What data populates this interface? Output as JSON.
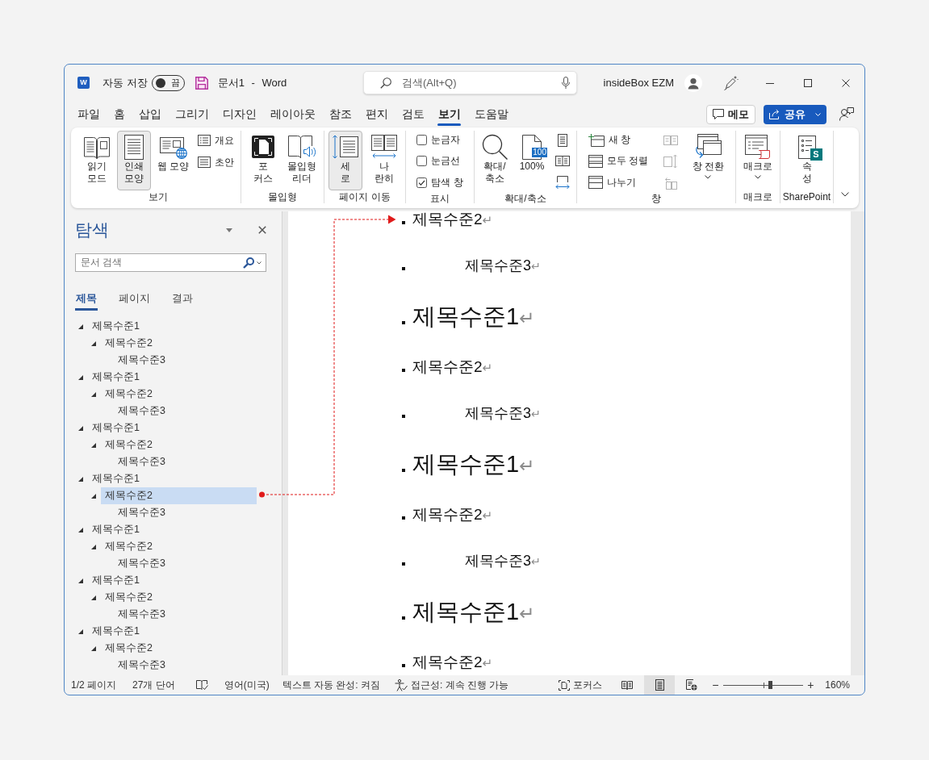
{
  "window": {
    "app_logo": "W",
    "autosave": {
      "label": "자동 저장",
      "on": false,
      "state_text": "끔"
    },
    "title": "문서1 - Word",
    "search": {
      "placeholder": "검색(Alt+Q)"
    },
    "user": "insideBox EZM"
  },
  "ribbon_tabs": [
    {
      "label": "파일",
      "selected": false
    },
    {
      "label": "홈",
      "selected": false
    },
    {
      "label": "삽입",
      "selected": false
    },
    {
      "label": "그리기",
      "selected": false
    },
    {
      "label": "디자인",
      "selected": false
    },
    {
      "label": "레이아웃",
      "selected": false
    },
    {
      "label": "참조",
      "selected": false
    },
    {
      "label": "편지",
      "selected": false
    },
    {
      "label": "검토",
      "selected": false
    },
    {
      "label": "보기",
      "selected": true
    },
    {
      "label": "도움말",
      "selected": false
    }
  ],
  "header_buttons": [
    {
      "kind": "comments",
      "label": "메모"
    },
    {
      "kind": "share",
      "label": "공유"
    }
  ],
  "ribbon": {
    "groups": [
      {
        "label": "보기",
        "items": [
          {
            "kind": "large",
            "label": "읽기\n모드",
            "selected": false
          },
          {
            "kind": "large",
            "label": "인쇄\n모양",
            "selected": true
          },
          {
            "kind": "large",
            "label": "웹 모양",
            "selected": false
          },
          {
            "kind": "stack",
            "items": [
              {
                "kind": "small",
                "label": "개요"
              },
              {
                "kind": "small",
                "label": "초안"
              }
            ]
          }
        ]
      },
      {
        "label": "몰입형",
        "items": [
          {
            "kind": "large",
            "label": "포\n커스"
          },
          {
            "kind": "large",
            "label": "몰입형\n리더"
          }
        ]
      },
      {
        "label": "페이지 이동",
        "items": [
          {
            "kind": "large",
            "label": "세\n로",
            "selected": true
          },
          {
            "kind": "large",
            "label": "나\n란히",
            "selected": false
          }
        ]
      },
      {
        "label": "표시",
        "items": [
          {
            "kind": "stack",
            "items": [
              {
                "kind": "checkbox",
                "label": "눈금자",
                "checked": false
              },
              {
                "kind": "checkbox",
                "label": "눈금선",
                "checked": false
              },
              {
                "kind": "checkbox",
                "label": "탐색 창",
                "checked": true
              }
            ]
          }
        ]
      },
      {
        "label": "확대/축소",
        "items": [
          {
            "kind": "large",
            "label": "확대/\n축소"
          },
          {
            "kind": "large",
            "label": "100%",
            "badge": "100"
          },
          {
            "kind": "stack",
            "items": [
              {
                "kind": "icon",
                "disabled": false
              },
              {
                "kind": "icon",
                "disabled": false
              },
              {
                "kind": "icon",
                "disabled": false
              }
            ]
          }
        ]
      },
      {
        "label": "창",
        "items": [
          {
            "kind": "stack",
            "items": [
              {
                "kind": "small",
                "label": "새 창"
              },
              {
                "kind": "small",
                "label": "모두 정렬"
              },
              {
                "kind": "small",
                "label": "나누기"
              }
            ]
          },
          {
            "kind": "stack",
            "items": [
              {
                "kind": "icon",
                "disabled": true
              },
              {
                "kind": "icon",
                "disabled": true
              },
              {
                "kind": "icon",
                "disabled": true
              }
            ]
          },
          {
            "kind": "large",
            "label": "창 전환",
            "dropdown": true
          }
        ]
      },
      {
        "label": "매크로",
        "items": [
          {
            "kind": "large",
            "label": "매크로",
            "dropdown": true
          }
        ]
      },
      {
        "label": "SharePoint",
        "items": [
          {
            "kind": "large",
            "label": "속\n성",
            "badge": "S"
          }
        ]
      }
    ]
  },
  "navigation": {
    "title": "탐색",
    "search": {
      "placeholder": "문서 검색"
    },
    "tabs": [
      {
        "label": "제목",
        "selected": true
      },
      {
        "label": "페이지",
        "selected": false
      },
      {
        "label": "결과",
        "selected": false
      }
    ],
    "headings": [
      {
        "text": "제목수준1",
        "expanded": true,
        "selected": false,
        "children": [
          {
            "text": "제목수준2",
            "expanded": true,
            "selected": false,
            "children": [
              {
                "text": "제목수준3",
                "selected": false
              }
            ]
          }
        ]
      },
      {
        "text": "제목수준1",
        "expanded": true,
        "selected": false,
        "children": [
          {
            "text": "제목수준2",
            "expanded": true,
            "selected": false,
            "children": [
              {
                "text": "제목수준3",
                "selected": false
              }
            ]
          }
        ]
      },
      {
        "text": "제목수준1",
        "expanded": true,
        "selected": false,
        "children": [
          {
            "text": "제목수준2",
            "expanded": true,
            "selected": false,
            "children": [
              {
                "text": "제목수준3",
                "selected": false
              }
            ]
          }
        ]
      },
      {
        "text": "제목수준1",
        "expanded": true,
        "selected": false,
        "children": [
          {
            "text": "제목수준2",
            "expanded": true,
            "selected": true,
            "children": [
              {
                "text": "제목수준3",
                "selected": false
              }
            ]
          }
        ]
      },
      {
        "text": "제목수준1",
        "expanded": true,
        "selected": false,
        "children": [
          {
            "text": "제목수준2",
            "expanded": true,
            "selected": false,
            "children": [
              {
                "text": "제목수준3",
                "selected": false
              }
            ]
          }
        ]
      },
      {
        "text": "제목수준1",
        "expanded": true,
        "selected": false,
        "children": [
          {
            "text": "제목수준2",
            "expanded": true,
            "selected": false,
            "children": [
              {
                "text": "제목수준3",
                "selected": false
              }
            ]
          }
        ]
      },
      {
        "text": "제목수준1",
        "expanded": true,
        "selected": false,
        "children": [
          {
            "text": "제목수준2",
            "expanded": true,
            "selected": false,
            "children": [
              {
                "text": "제목수준3",
                "selected": false
              }
            ]
          }
        ]
      }
    ]
  },
  "document": {
    "paragraphs": [
      {
        "kind": "heading2",
        "text": "제목수준2",
        "mark": "↵"
      },
      {
        "kind": "heading3",
        "text": "제목수준3",
        "mark": "↵"
      },
      {
        "kind": "heading1",
        "text": "제목수준1",
        "mark": "↵"
      },
      {
        "kind": "heading2",
        "text": "제목수준2",
        "mark": "↵"
      },
      {
        "kind": "heading3",
        "text": "제목수준3",
        "mark": "↵"
      },
      {
        "kind": "heading1",
        "text": "제목수준1",
        "mark": "↵"
      },
      {
        "kind": "heading2",
        "text": "제목수준2",
        "mark": "↵"
      },
      {
        "kind": "heading3",
        "text": "제목수준3",
        "mark": "↵"
      },
      {
        "kind": "heading1",
        "text": "제목수준1",
        "mark": "↵"
      },
      {
        "kind": "heading2",
        "text": "제목수준2",
        "mark": "↵"
      }
    ]
  },
  "annotations": [
    {
      "kind": "elbow-arrow"
    }
  ],
  "status_bar": {
    "page": "1/2 페이지",
    "words": "27개 단어",
    "language": "영어(미국)",
    "text_predictions": "텍스트 자동 완성: 켜짐",
    "accessibility": "접근성: 계속 진행 가능",
    "focus": "포커스",
    "views": [
      {
        "selected": false
      },
      {
        "selected": true
      },
      {
        "selected": false
      }
    ],
    "zoom_out": "−",
    "zoom_in": "+",
    "zoom": {
      "level": 0.58,
      "reading": "160%"
    }
  }
}
